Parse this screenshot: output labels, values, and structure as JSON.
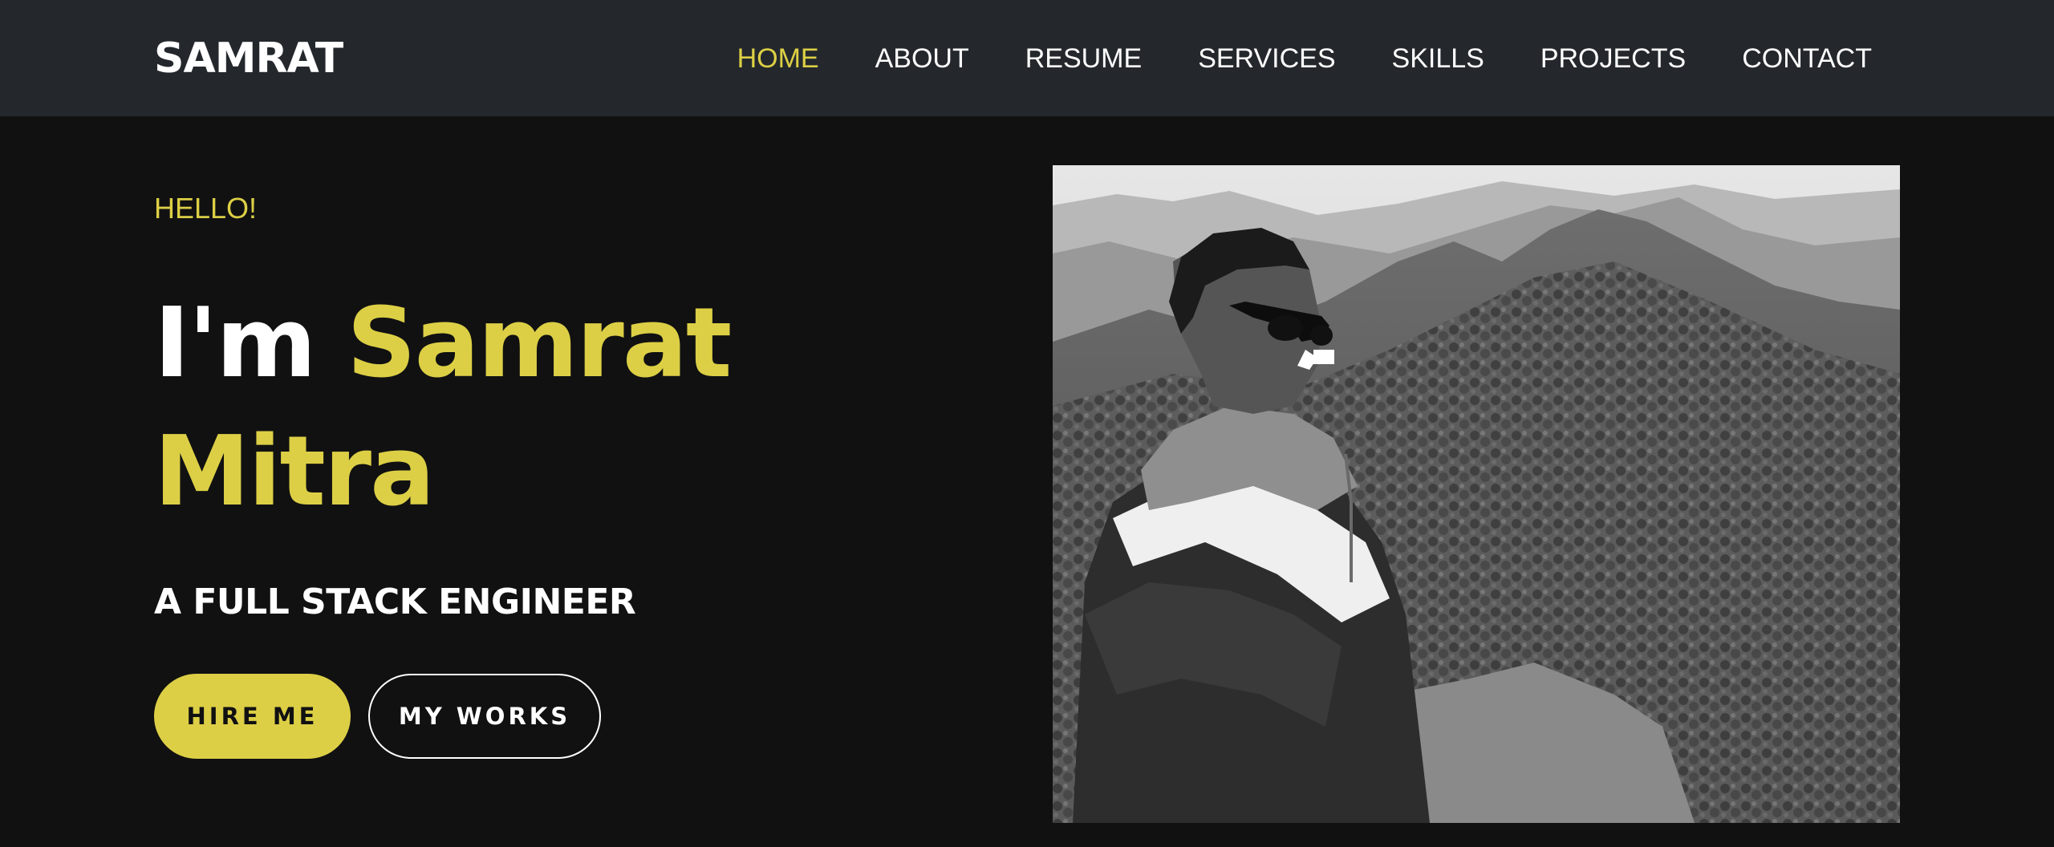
{
  "brand": {
    "name": "SAMRAT"
  },
  "nav": {
    "items": [
      {
        "label": "HOME",
        "active": true
      },
      {
        "label": "ABOUT",
        "active": false
      },
      {
        "label": "RESUME",
        "active": false
      },
      {
        "label": "SERVICES",
        "active": false
      },
      {
        "label": "SKILLS",
        "active": false
      },
      {
        "label": "PROJECTS",
        "active": false
      },
      {
        "label": "CONTACT",
        "active": false
      }
    ]
  },
  "hero": {
    "greeting": "HELLO!",
    "intro": "I'm",
    "first_name": "Samrat",
    "last_name": "Mitra",
    "subtitle": "A FULL STACK ENGINEER",
    "hire_label": "HIRE ME",
    "works_label": "MY WORKS"
  },
  "colors": {
    "accent": "#dccf45",
    "navbar_bg": "#24282d",
    "page_bg": "#111112",
    "text": "#ffffff"
  }
}
